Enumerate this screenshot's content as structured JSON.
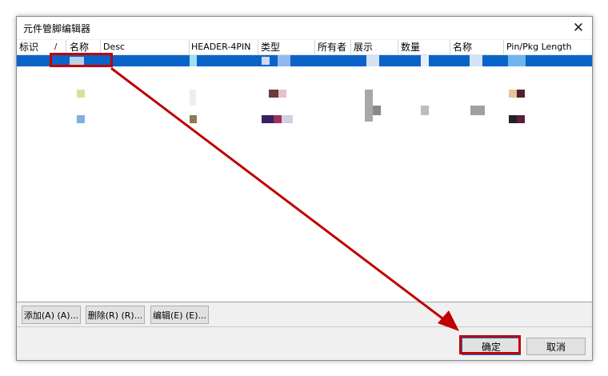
{
  "window": {
    "title": "元件管脚编辑器",
    "close_glyph": "✕"
  },
  "table": {
    "columns": [
      "标识",
      "/",
      "名称",
      "Desc",
      "HEADER-4PIN",
      "类型",
      "所有者",
      "展示",
      "数量",
      "名称",
      "Pin/Pkg Length"
    ],
    "selected_row_color": "#0a63c9"
  },
  "toolbar": {
    "add_label": "添加(A) (A)...",
    "delete_label": "删除(R) (R)...",
    "edit_label": "编辑(E) (E)..."
  },
  "footer": {
    "ok_label": "确定",
    "cancel_label": "取消"
  },
  "annotation": {
    "color": "#c00000"
  }
}
